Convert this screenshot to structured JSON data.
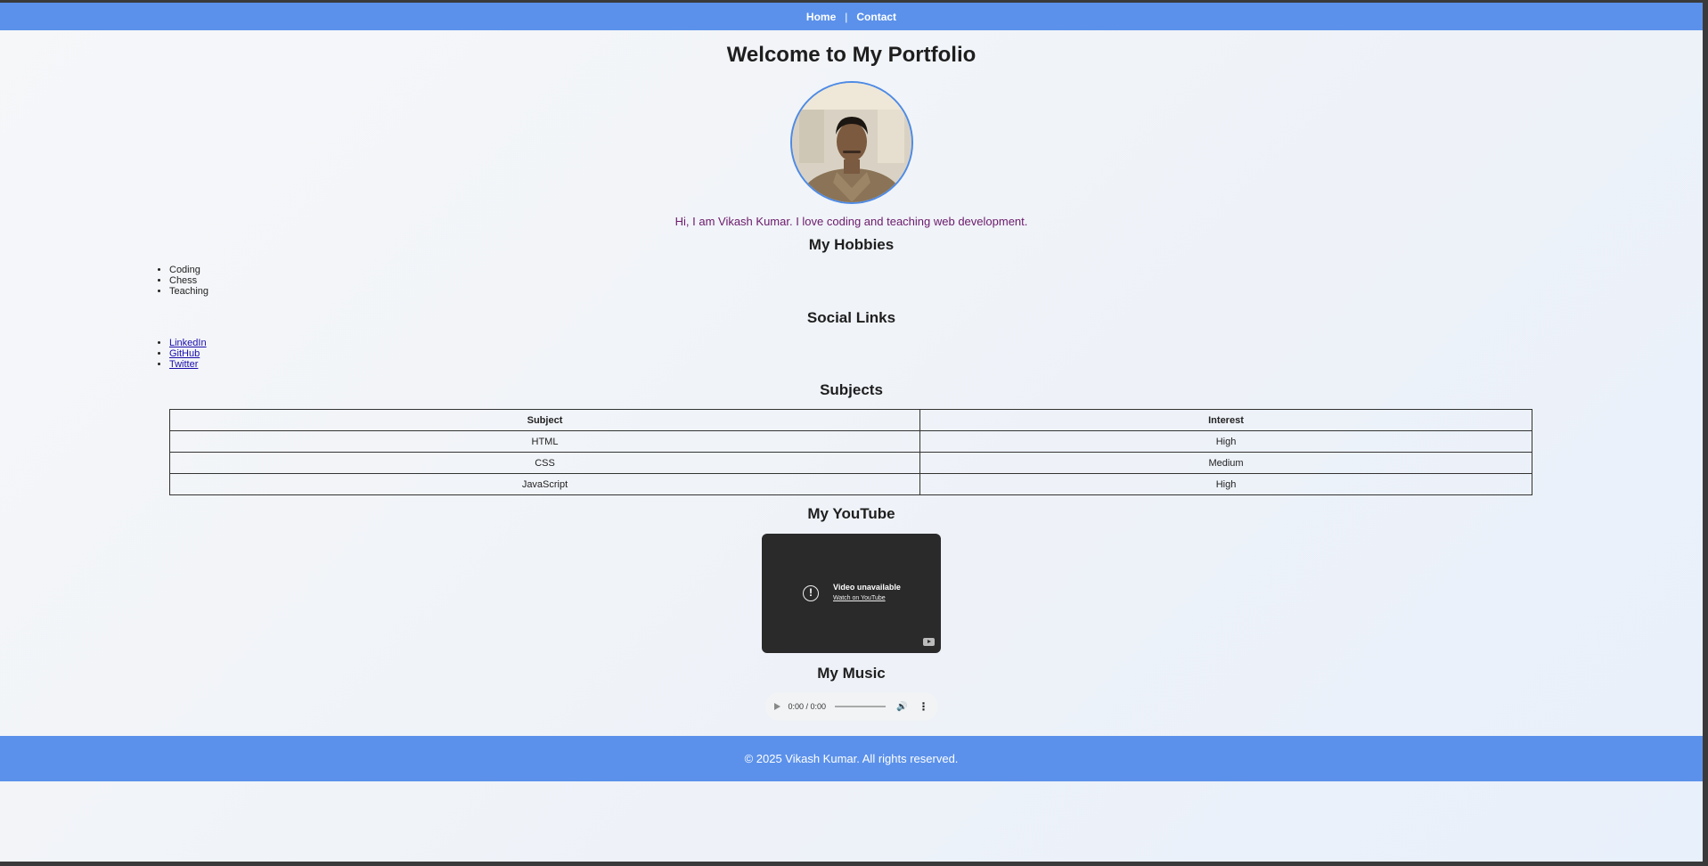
{
  "nav": {
    "items": [
      {
        "label": "Home"
      },
      {
        "label": "Contact"
      }
    ],
    "separator": "|"
  },
  "header": {
    "title": "Welcome to My Portfolio",
    "avatar_icon": "profile-photo",
    "intro": "Hi, I am Vikash Kumar. I love coding and teaching web development."
  },
  "hobbies": {
    "title": "My Hobbies",
    "items": [
      "Coding",
      "Chess",
      "Teaching"
    ]
  },
  "social": {
    "title": "Social Links",
    "links": [
      "LinkedIn",
      "GitHub",
      "Twitter"
    ]
  },
  "subjects": {
    "title": "Subjects",
    "headers": [
      "Subject",
      "Interest"
    ],
    "rows": [
      [
        "HTML",
        "High"
      ],
      [
        "CSS",
        "Medium"
      ],
      [
        "JavaScript",
        "High"
      ]
    ]
  },
  "youtube": {
    "title": "My YouTube",
    "status": "Video unavailable",
    "link": "Watch on YouTube",
    "icon": "alert-circle-icon"
  },
  "music": {
    "title": "My Music",
    "time": "0:00 / 0:00",
    "progress": 0
  },
  "footer": {
    "text": "© 2025 Vikash Kumar. All rights reserved."
  },
  "colors": {
    "nav_bg": "#5b91eb",
    "footer_bg": "#5b91eb",
    "intro_text": "#6b1a6b",
    "link": "#1a0dab",
    "avatar_border": "#4d8ae6"
  }
}
